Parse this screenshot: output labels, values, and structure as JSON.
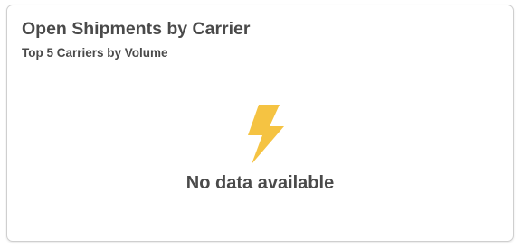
{
  "card": {
    "title": "Open Shipments by Carrier",
    "subtitle": "Top 5 Carriers by Volume",
    "empty_state": {
      "icon": "lightning-bolt-icon",
      "message": "No data available"
    }
  },
  "colors": {
    "text": "#4a4a4a",
    "bolt": "#f5c342",
    "border": "#cfcfcf",
    "background": "#ffffff"
  }
}
